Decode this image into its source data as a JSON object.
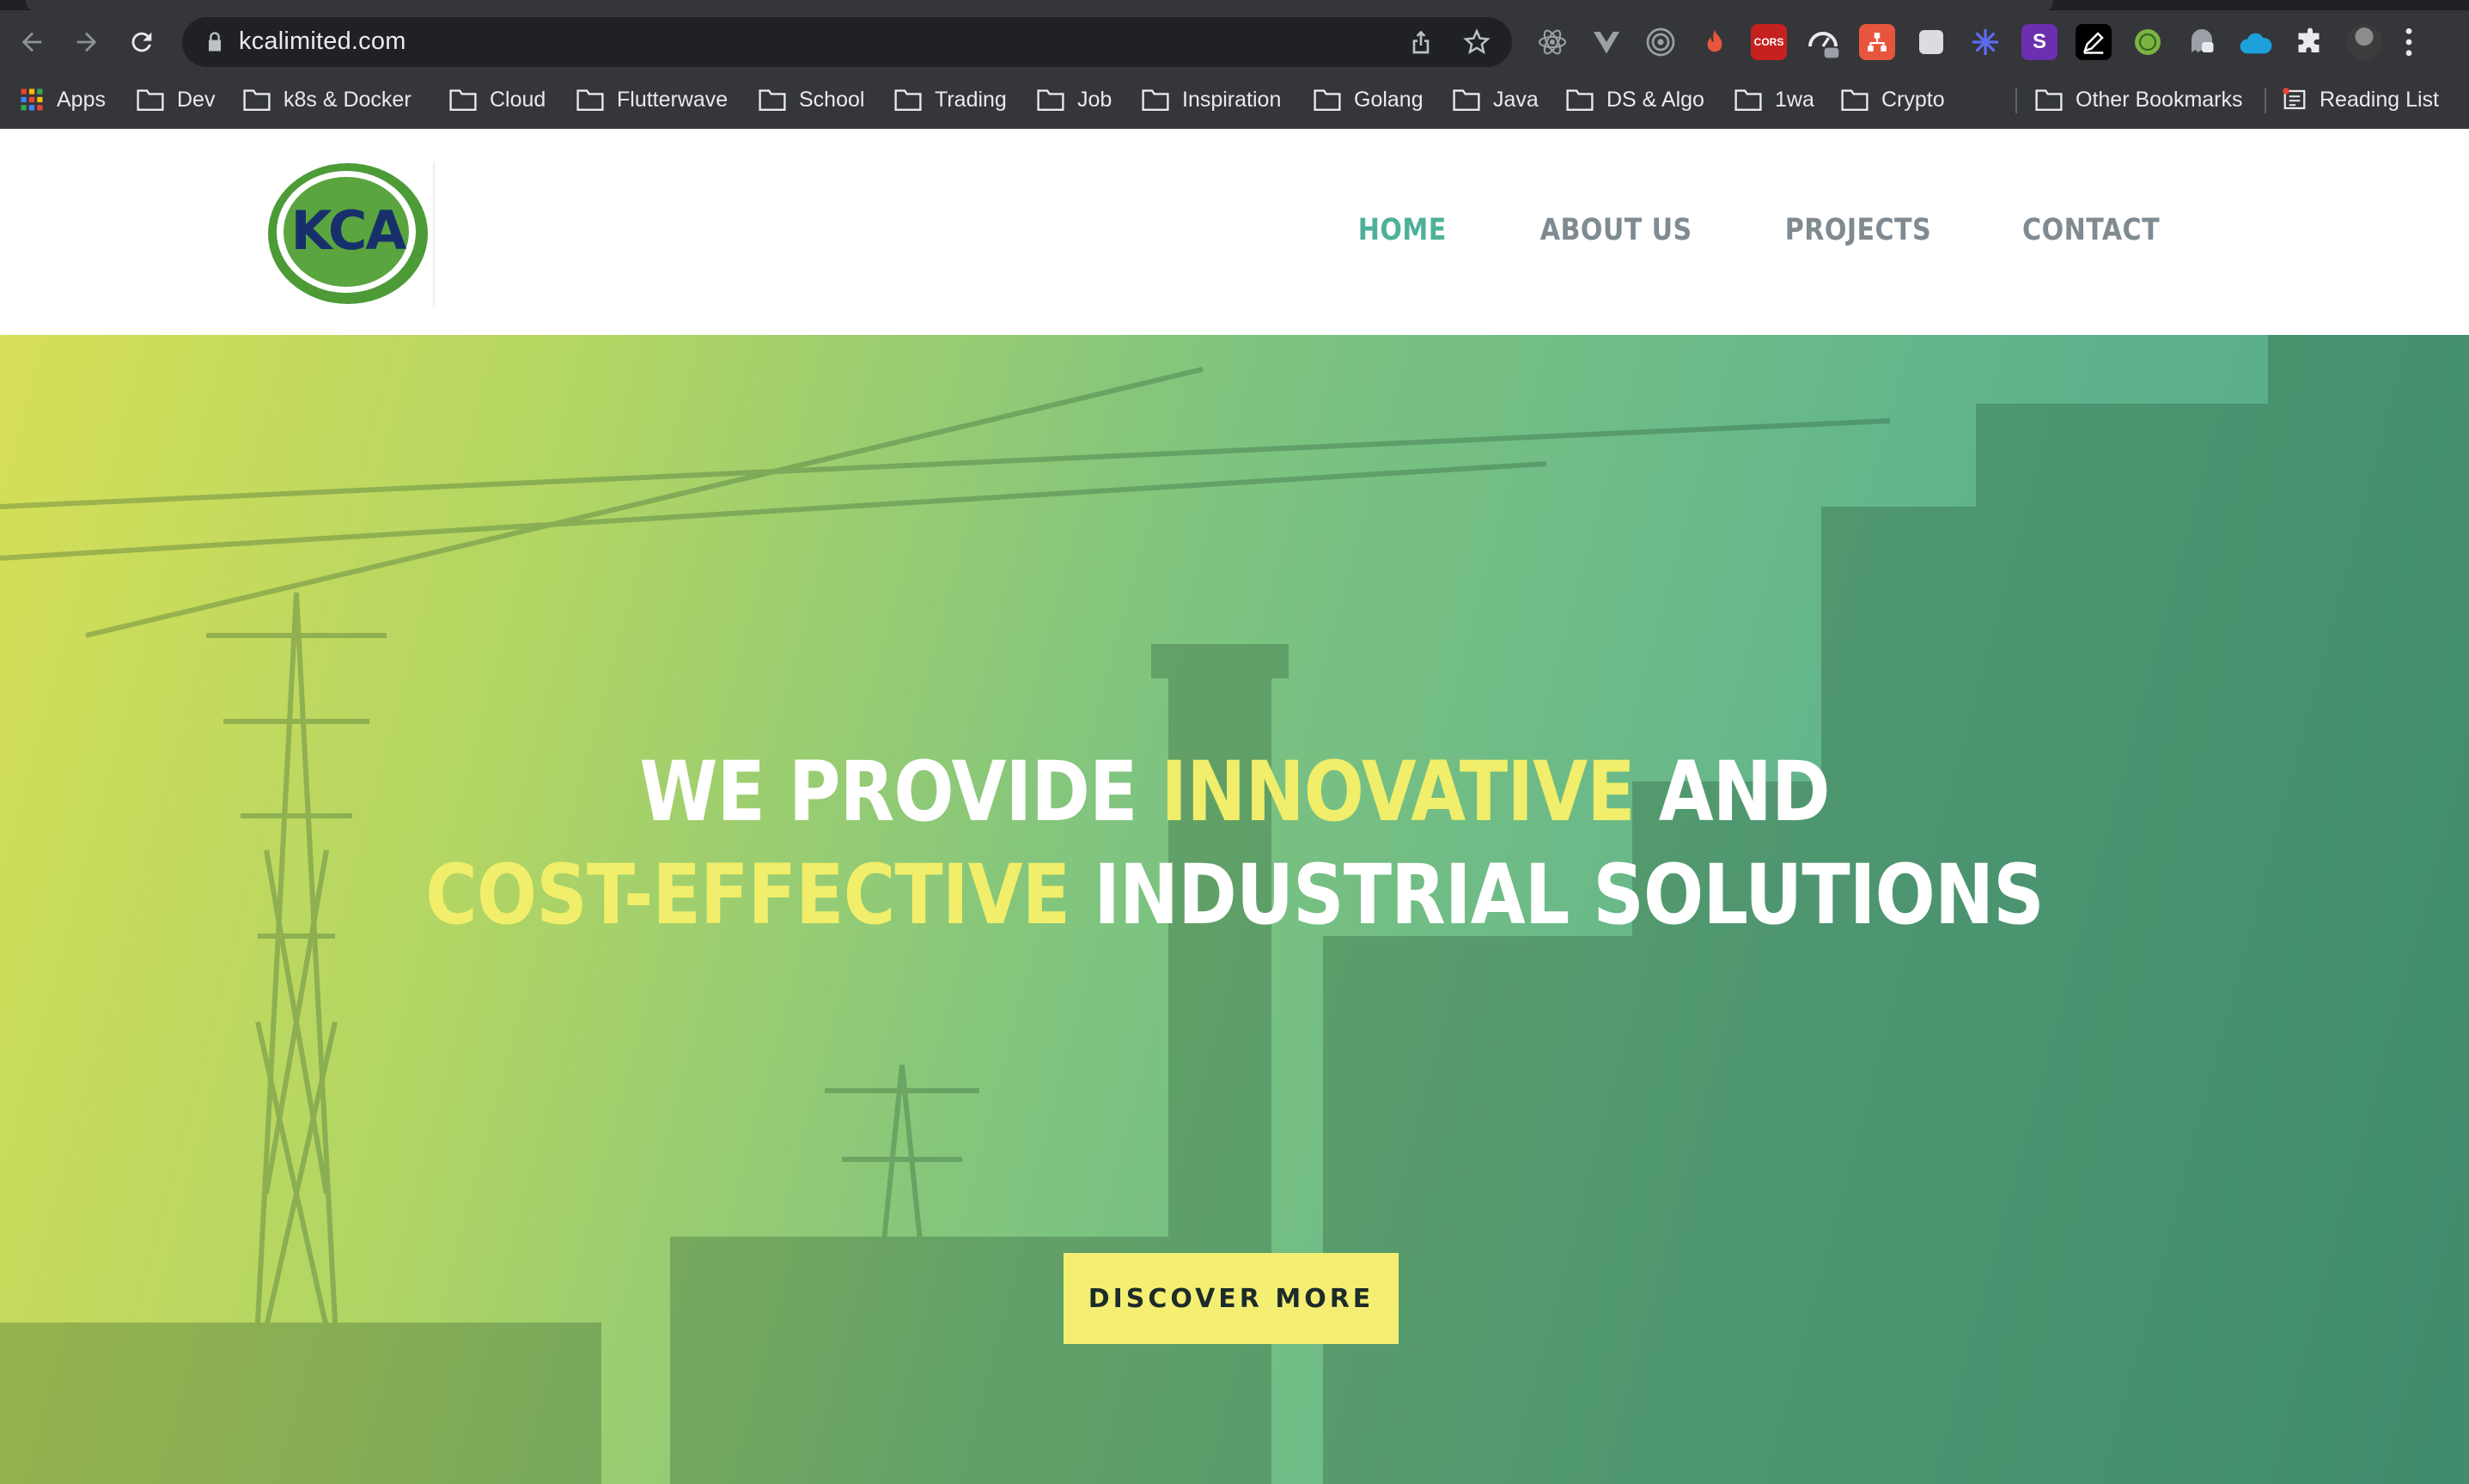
{
  "browser": {
    "url": "kcalimited.com",
    "extensions": [
      {
        "icon": "react-devtools-icon",
        "label": ""
      },
      {
        "icon": "vue-devtools-icon",
        "label": ""
      },
      {
        "icon": "target-icon",
        "label": ""
      },
      {
        "icon": "fire-extension-icon",
        "label": ""
      },
      {
        "icon": "cors-extension-icon",
        "label": "CORS"
      },
      {
        "icon": "gauge-extension-icon",
        "label": ""
      },
      {
        "icon": "network-extension-icon",
        "label": ""
      },
      {
        "icon": "note-extension-icon",
        "label": ""
      },
      {
        "icon": "asterisk-extension-icon",
        "label": ""
      },
      {
        "icon": "s-extension-icon",
        "label": "S"
      },
      {
        "icon": "pen-extension-icon",
        "label": ""
      },
      {
        "icon": "globe-extension-icon",
        "label": ""
      },
      {
        "icon": "ghost-extension-icon",
        "label": ""
      },
      {
        "icon": "salesforce-cloud-icon",
        "label": ""
      },
      {
        "icon": "puzzle-icon",
        "label": ""
      },
      {
        "icon": "profile-avatar",
        "label": ""
      },
      {
        "icon": "kebab-menu-icon",
        "label": ""
      }
    ],
    "bookmarks": {
      "apps": "Apps",
      "items": [
        "Dev",
        "k8s & Docker",
        "Cloud",
        "Flutterwave",
        "School",
        "Trading",
        "Job",
        "Inspiration",
        "Golang",
        "Java",
        "DS & Algo",
        "1wa",
        "Crypto"
      ],
      "other": "Other Bookmarks",
      "reading_list": "Reading List"
    }
  },
  "site": {
    "logo_text": "KCA",
    "nav": [
      "HOME",
      "ABOUT US",
      "PROJECTS",
      "CONTACT"
    ],
    "active_nav": "HOME",
    "hero": {
      "line1_a": "WE PROVIDE ",
      "line1_b": "INNOVATIVE",
      "line1_c": " AND",
      "line2_a": "COST-EFFECTIVE",
      "line2_b": " INDUSTRIAL SOLUTIONS",
      "cta": "DISCOVER MORE"
    }
  },
  "colors": {
    "chrome_bg": "#35363a",
    "accent_green": "#4fb09a",
    "hero_highlight": "#f0ee6a",
    "cta_bg": "#f4ef72"
  }
}
